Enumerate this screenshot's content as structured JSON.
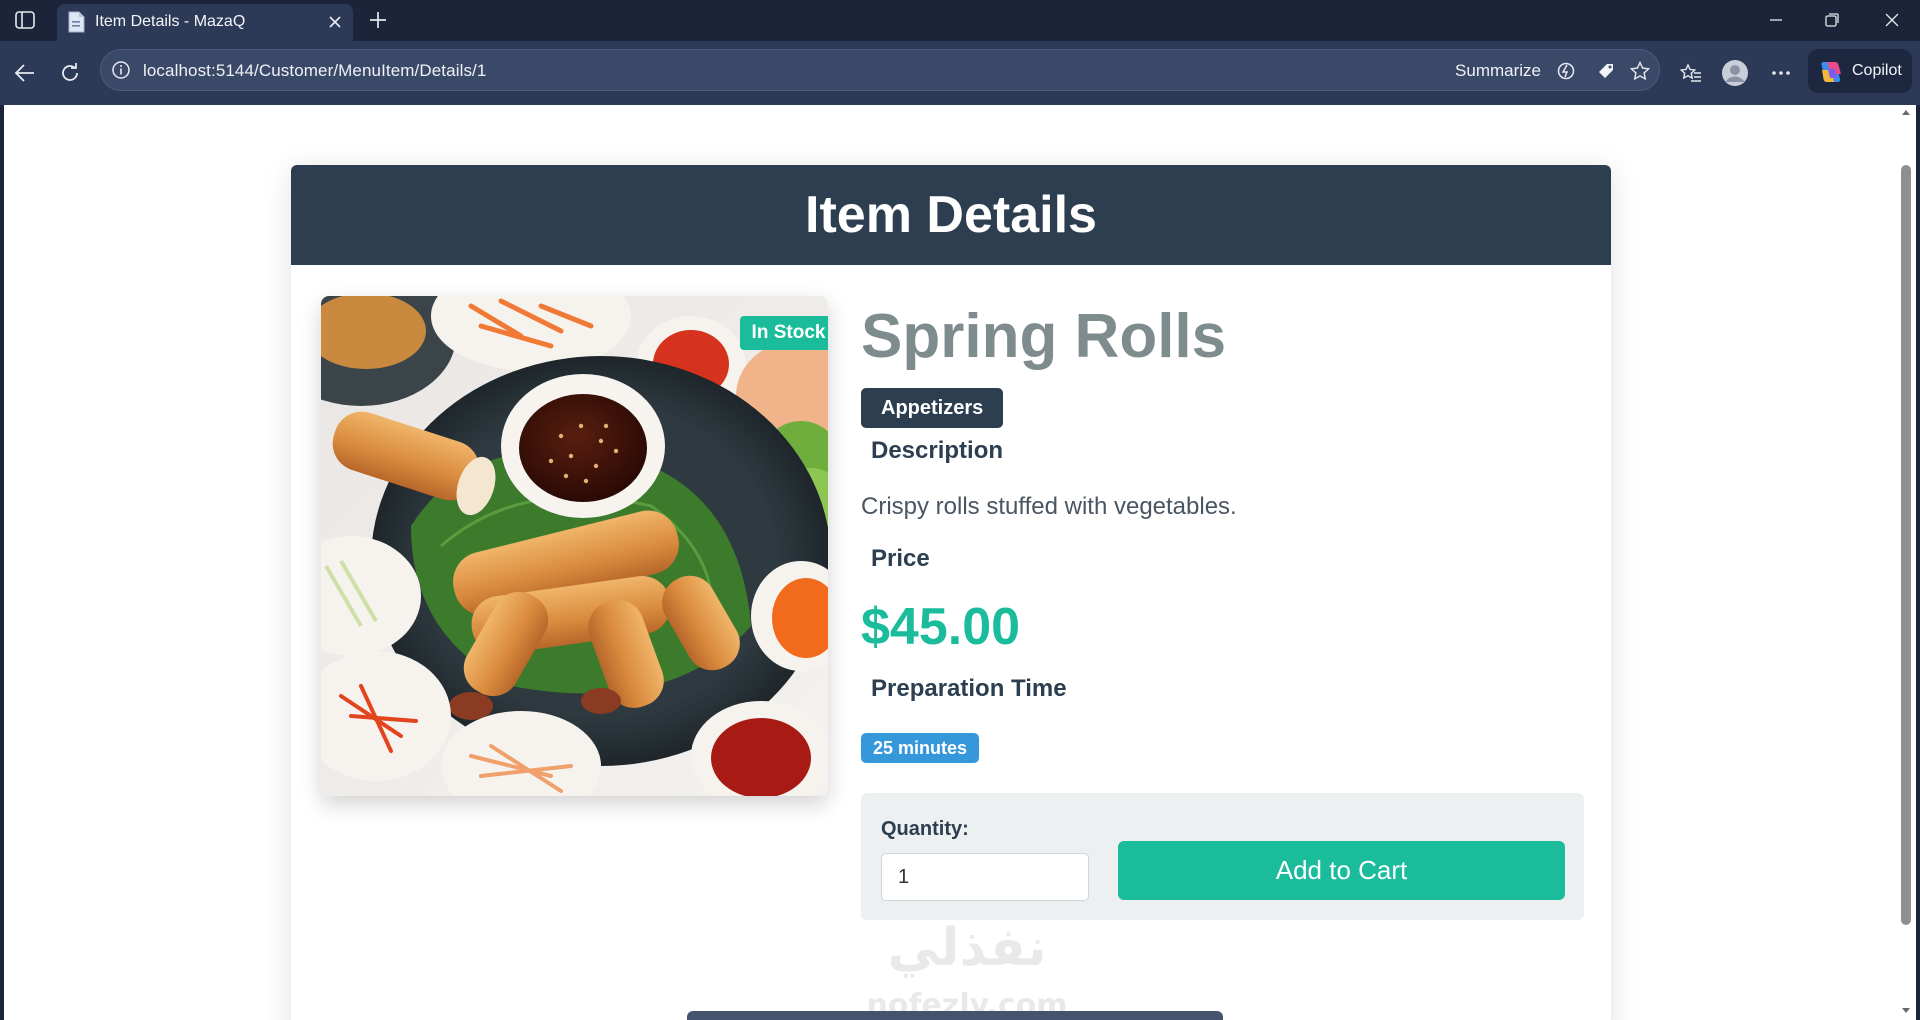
{
  "browser": {
    "tab_title": "Item Details - MazaQ",
    "url": "localhost:5144/Customer/MenuItem/Details/1",
    "summarize_label": "Summarize",
    "copilot_label": "Copilot"
  },
  "page": {
    "header_title": "Item Details",
    "item_name": "Spring Rolls",
    "stock_status": "In Stock",
    "category": "Appetizers",
    "description_label": "Description",
    "description": "Crispy rolls stuffed with vegetables.",
    "price_label": "Price",
    "price": "$45.00",
    "prep_label": "Preparation Time",
    "prep_time": "25 minutes",
    "quantity_label": "Quantity:",
    "quantity_value": "1",
    "add_to_cart_label": "Add to Cart"
  },
  "watermark": {
    "text_ar": "نفذلي",
    "text_en": "nofezly.com"
  },
  "colors": {
    "header": "#2c3e50",
    "accent": "#1abc9c",
    "info": "#3498db",
    "muted": "#7f8c8d"
  }
}
